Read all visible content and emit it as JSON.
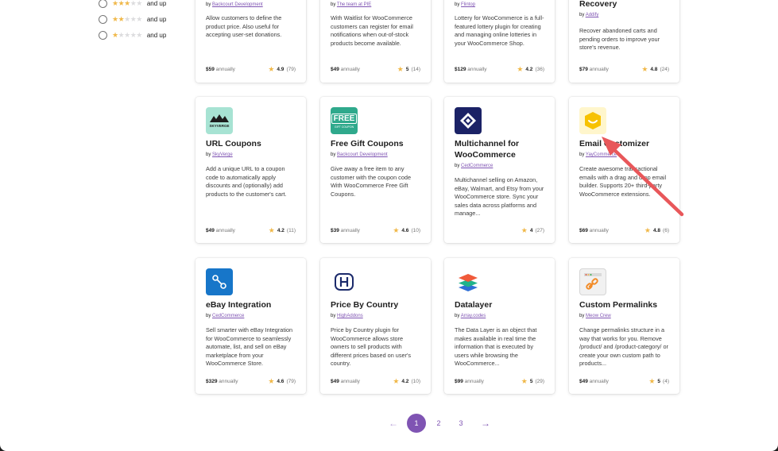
{
  "rating_filter": [
    {
      "stars_on": 3,
      "stars_off": 2,
      "suffix": "and up"
    },
    {
      "stars_on": 2,
      "stars_off": 3,
      "suffix": "and up"
    },
    {
      "stars_on": 1,
      "stars_off": 4,
      "suffix": "and up"
    }
  ],
  "cards": [
    {
      "title": "",
      "by_prefix": "by",
      "author": "Backcourt Development",
      "description": "Allow customers to define the product price. Also useful for accepting user-set donations.",
      "price": "$59",
      "term": "annually",
      "score": "4.9",
      "count": "(79)"
    },
    {
      "title": "",
      "by_prefix": "by",
      "author": "The team at PIE",
      "description": "With Waitlist for WooCommerce customers can register for email notifications when out-of-stock products become available.",
      "price": "$49",
      "term": "annually",
      "score": "5",
      "count": "(14)"
    },
    {
      "title": "",
      "by_prefix": "by",
      "author": "Flintop",
      "description": "Lottery for WooCommerce is a full-featured lottery plugin for creating and managing online lotteries in your WooCommerce Shop.",
      "price": "$129",
      "term": "annually",
      "score": "4.2",
      "count": "(36)"
    },
    {
      "title": "Recovery",
      "by_prefix": "by",
      "author": "Addify",
      "description": "Recover abandoned carts and pending orders to improve your store's revenue.",
      "price": "$79",
      "term": "annually",
      "score": "4.8",
      "count": "(24)"
    },
    {
      "title": "URL Coupons",
      "by_prefix": "by",
      "author": "SkyVerge",
      "description": "Add a unique URL to a coupon code to automatically apply discounts and (optionally) add products to the customer's cart.",
      "price": "$49",
      "term": "annually",
      "score": "4.2",
      "count": "(11)",
      "icon": "skyverge-logo-icon",
      "icon_text": "SKYVERGE"
    },
    {
      "title": "Free Gift Coupons",
      "by_prefix": "by",
      "author": "Backcourt Development",
      "description": "Give away a free item to any customer with the coupon code With WooCommerce Free Gift Coupons.",
      "price": "$39",
      "term": "annually",
      "score": "4.6",
      "count": "(10)",
      "icon": "free-gift-coupon-icon",
      "icon_text": "FREE",
      "icon_subtext": "GIFT COUPON"
    },
    {
      "title": "Multichannel for WooCommerce",
      "by_prefix": "by",
      "author": "CedCommerce",
      "description": "Multichannel selling on Amazon, eBay, Walmart, and Etsy from your WooCommerce store. Sync your sales data across platforms and manage...",
      "price": "",
      "term": "",
      "score": "4",
      "count": "(27)",
      "icon": "multichannel-logo-icon"
    },
    {
      "title": "Email Customizer",
      "by_prefix": "by",
      "author": "YayCommerce",
      "description": "Create awesome transactional emails with a drag and drop email builder. Supports 20+ third-party WooCommerce extensions.",
      "price": "$69",
      "term": "annually",
      "score": "4.8",
      "count": "(6)",
      "icon": "yaycommerce-logo-icon"
    },
    {
      "title": "eBay Integration",
      "by_prefix": "by",
      "author": "CedCommerce",
      "description": "Sell smarter with eBay Integration for WooCommerce to seamlessly automate, list, and sell on eBay marketplace from your WooCommerce Store.",
      "price": "$329",
      "term": "annually",
      "score": "4.6",
      "count": "(79)",
      "icon": "ebay-integration-logo-icon"
    },
    {
      "title": "Price By Country",
      "by_prefix": "by",
      "author": "HighAddons",
      "description": "Price by Country plugin for WooCommerce allows store owners to sell products with different prices based on user's country.",
      "price": "$49",
      "term": "annually",
      "score": "4.2",
      "count": "(10)",
      "icon": "highaddons-logo-icon"
    },
    {
      "title": "Datalayer",
      "by_prefix": "by",
      "author": "Array.codes",
      "description": "The Data Layer is an object that makes available in real time the information that is executed by users while browsing the WooCommerce...",
      "price": "$99",
      "term": "annually",
      "score": "5",
      "count": "(29)",
      "icon": "layers-logo-icon"
    },
    {
      "title": "Custom Permalinks",
      "by_prefix": "by",
      "author": "Meow Crew",
      "description": "Change permalinks structure in a way that works for you. Remove /product/ and /product-category/ or create your own custom path to products...",
      "price": "$49",
      "term": "annually",
      "score": "5",
      "count": "(4)",
      "icon": "permalink-chain-icon"
    }
  ],
  "pagination": {
    "prev": "←",
    "pages": [
      "1",
      "2",
      "3"
    ],
    "current": "1",
    "next": "→"
  },
  "colors": {
    "accent": "#7f54b3",
    "star": "#f0b849",
    "annotation_arrow": "#e8575a"
  }
}
